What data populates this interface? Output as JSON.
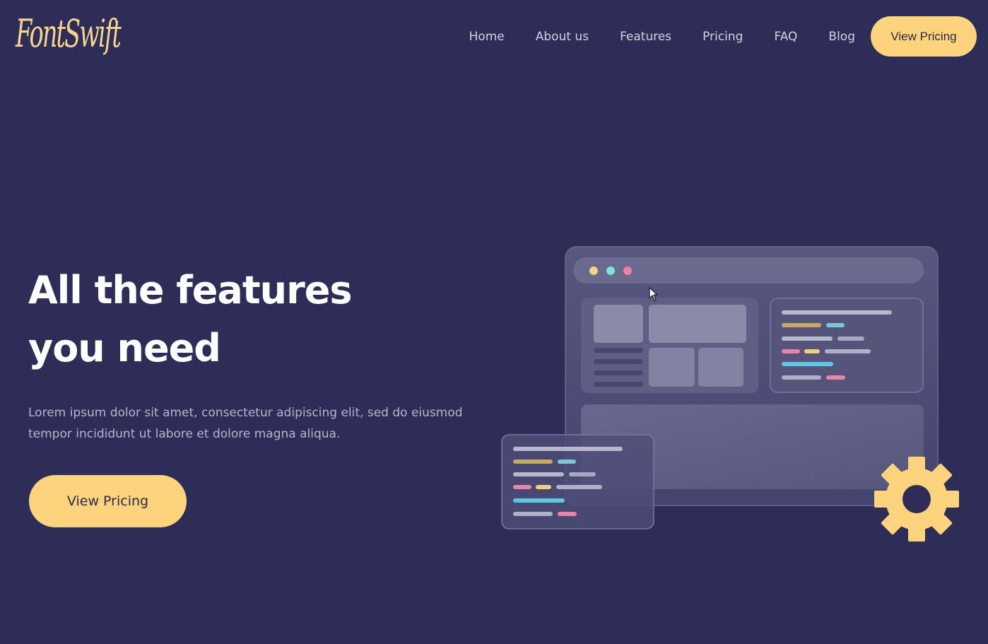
{
  "brand": {
    "logo_text": "FontSwift",
    "accent_color": "#fdd47d",
    "background_color": "#2d2d57"
  },
  "nav": {
    "items": [
      {
        "label": "Home"
      },
      {
        "label": "About us"
      },
      {
        "label": "Features"
      },
      {
        "label": "Pricing"
      },
      {
        "label": "FAQ"
      },
      {
        "label": "Blog"
      }
    ],
    "cta_label": "View Pricing"
  },
  "hero": {
    "title_line1": "All the features",
    "title_line2": "you need",
    "subtitle_line1": "Lorem ipsum dolor sit amet, consectetur adipiscing elit, sed do eiusmod",
    "subtitle_line2": "tempor incididunt ut labore et dolore magna aliqua.",
    "cta_label": "View Pricing"
  },
  "illustration": {
    "window_dot_colors": [
      "#fdd47d",
      "#7fe3d6",
      "#f07fa6"
    ],
    "gear_color": "#fdd47d",
    "icons": [
      "browser-window-icon",
      "code-snippet-icon",
      "gear-icon",
      "mouse-cursor-icon"
    ]
  }
}
